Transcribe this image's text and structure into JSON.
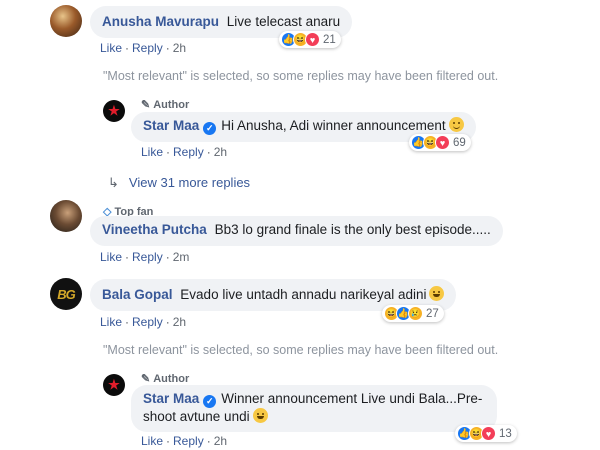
{
  "comments": [
    {
      "name": "Anusha Mavurapu",
      "text": "Live telecast anaru",
      "actions": {
        "like": "Like",
        "reply": "Reply",
        "time": "2h"
      },
      "reactions": {
        "icons": [
          "like",
          "haha",
          "love"
        ],
        "count": "21"
      }
    },
    {
      "badge": "Author",
      "name": "Star Maa",
      "verified": true,
      "text": "Hi Anusha, Adi winner announcement",
      "actions": {
        "like": "Like",
        "reply": "Reply",
        "time": "2h"
      },
      "reactions": {
        "icons": [
          "like",
          "haha",
          "love"
        ],
        "count": "69"
      }
    },
    {
      "badge": "Top fan",
      "name": "Vineetha Putcha",
      "text": "Bb3 lo grand finale is the only best episode.....",
      "actions": {
        "like": "Like",
        "reply": "Reply",
        "time": "2m"
      }
    },
    {
      "name": "Bala Gopal",
      "text": "Evado live untadh annadu narikeyal adini",
      "actions": {
        "like": "Like",
        "reply": "Reply",
        "time": "2h"
      },
      "reactions": {
        "icons": [
          "haha",
          "like",
          "sad"
        ],
        "count": "27"
      }
    },
    {
      "badge": "Author",
      "name": "Star Maa",
      "verified": true,
      "text_line1": "Winner announcement Live undi Bala...Pre-",
      "text_line2": "shoot avtune undi",
      "actions": {
        "like": "Like",
        "reply": "Reply",
        "time": "2h"
      },
      "reactions": {
        "icons": [
          "like",
          "haha",
          "love"
        ],
        "count": "13"
      }
    }
  ],
  "filtered_notice": "\"Most relevant\" is selected, so some replies may have been filtered out.",
  "more_replies": "View 31 more replies",
  "avatar_text": {
    "bala": "BG",
    "starmaa": "★"
  },
  "colors": {
    "link": "#385898",
    "bubble": "#f0f2f5",
    "like": "#1877f2",
    "love": "#f33e58",
    "haha": "#f7b125"
  }
}
